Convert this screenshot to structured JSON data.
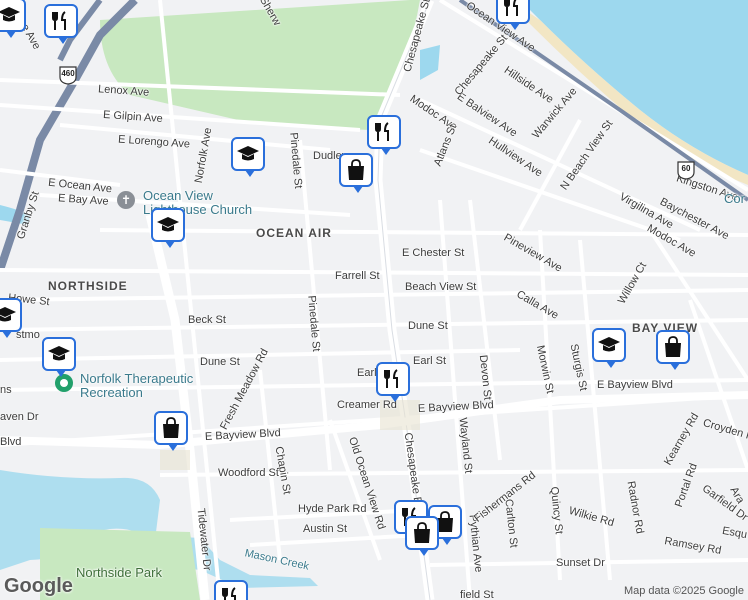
{
  "map": {
    "neighborhoods": [
      "OCEAN AIR",
      "NORTHSIDE",
      "BAY VIEW"
    ],
    "streets": {
      "ocean_view_ave": "Ocean View Ave",
      "chesapeake_st": "Chesapeake St",
      "chesapeake_blvd": "Chesapeake Blvd",
      "lenox_ave": "Lenox Ave",
      "e_gilpin_ave": "E Gilpin Ave",
      "e_lorengo_ave": "E Lorengo Ave",
      "e_ocean_ave": "E Ocean Ave",
      "e_bay_ave": "E Bay Ave",
      "norfolk_ave": "Norfolk Ave",
      "dudley": "Dudley",
      "pinedale_st": "Pinedale St",
      "pinedale_st2": "Pinedale St",
      "granby_st": "Granby St",
      "e_chester_st": "E Chester St",
      "farrell_st": "Farrell St",
      "beach_view_st": "Beach View St",
      "howe_st": "Howe St",
      "beck_st": "Beck St",
      "dune_st": "Dune St",
      "dune_st2": "Dune St",
      "earl_st": "Earl St",
      "earl_st_w": "Earl",
      "creamer_rd": "Creamer Rd",
      "fresh_meadow_rd": "Fresh Meadow Rd",
      "e_bayview_blvd": "E Bayview Blvd",
      "e_bayview_blvd2": "E Bayview Blvd",
      "e_bayview_blvd3": "E Bayview Blvd",
      "woodford_st": "Woodford St",
      "chapin_st": "Chapin St",
      "old_ocean_view_rd": "Old Ocean View Rd",
      "hyde_park_rd": "Hyde Park Rd",
      "austin_st": "Austin St",
      "tidewater_dr": "Tidewater Dr",
      "mason_creek": "Mason Creek",
      "wayland_st": "Wayland St",
      "devon_st": "Devon St",
      "pythian_ave": "Pythian Ave",
      "carlton_st": "Carlton St",
      "quincy_st": "Quincy St",
      "fishermans_rd": "Fishermans Rd",
      "wilkie_rd": "Wilkie Rd",
      "radnor_rd": "Radnor Rd",
      "ramsey_rd": "Ramsey Rd",
      "sunset_dr": "Sunset Dr",
      "portal_rd": "Portal Rd",
      "kearney_rd": "Kearney Rd",
      "croyden_r": "Croyden R",
      "garfield_dr": "Garfield Dr",
      "ara": "Ara",
      "esqu": "Esqu",
      "morwin_st": "Morwin St",
      "sturgis_st": "Sturgis St",
      "calla_ave": "Calla Ave",
      "pineview_ave": "Pineview Ave",
      "modoc_ave": "Modoc Ave",
      "modoc_ave2": "Modoc Ave",
      "atlans_st": "Atlans St",
      "hullview_ave": "Hullview Ave",
      "e_balview_ave": "E Balview Ave",
      "hillside_ave": "Hillside Ave",
      "warwick_ave": "Warwick Ave",
      "n_beach_view_st": "N Beach View St",
      "kingston_ave": "Kingston Ave",
      "baychester_ave": "Baychester Ave",
      "virgilina_ave": "Virgilina Ave",
      "willow_ct": "Willow Ct",
      "chesapeake_st2": "Chesapeake St",
      "sherw": "Sherw",
      "range_ave": "range Ave",
      "eastmo": "stmo",
      "haven_dr": "aven Dr",
      "blvd_w": "Blvd",
      "ns": "ns",
      "ield_st": "field St",
      "cor": "Cor"
    },
    "pois": {
      "church": "Ocean View\nLighthouse Church",
      "recreation": "Norfolk Therapeutic\nRecreation",
      "park": "Northside Park"
    },
    "shields": {
      "us460": "460",
      "us60": "60"
    },
    "icons": [
      "restaurant-icon",
      "school-icon",
      "shopping-bag-icon",
      "church-icon",
      "recreation-icon"
    ],
    "colors": {
      "water": "#9dd8ee",
      "park": "#c8e8c0",
      "road": "#ffffff",
      "highway": "#7a8aa6",
      "pin_border": "#2a6fdb",
      "sand": "#f2e6c4"
    }
  },
  "footer": {
    "google": "Google",
    "copyright": "Map data ©2025 Google"
  }
}
